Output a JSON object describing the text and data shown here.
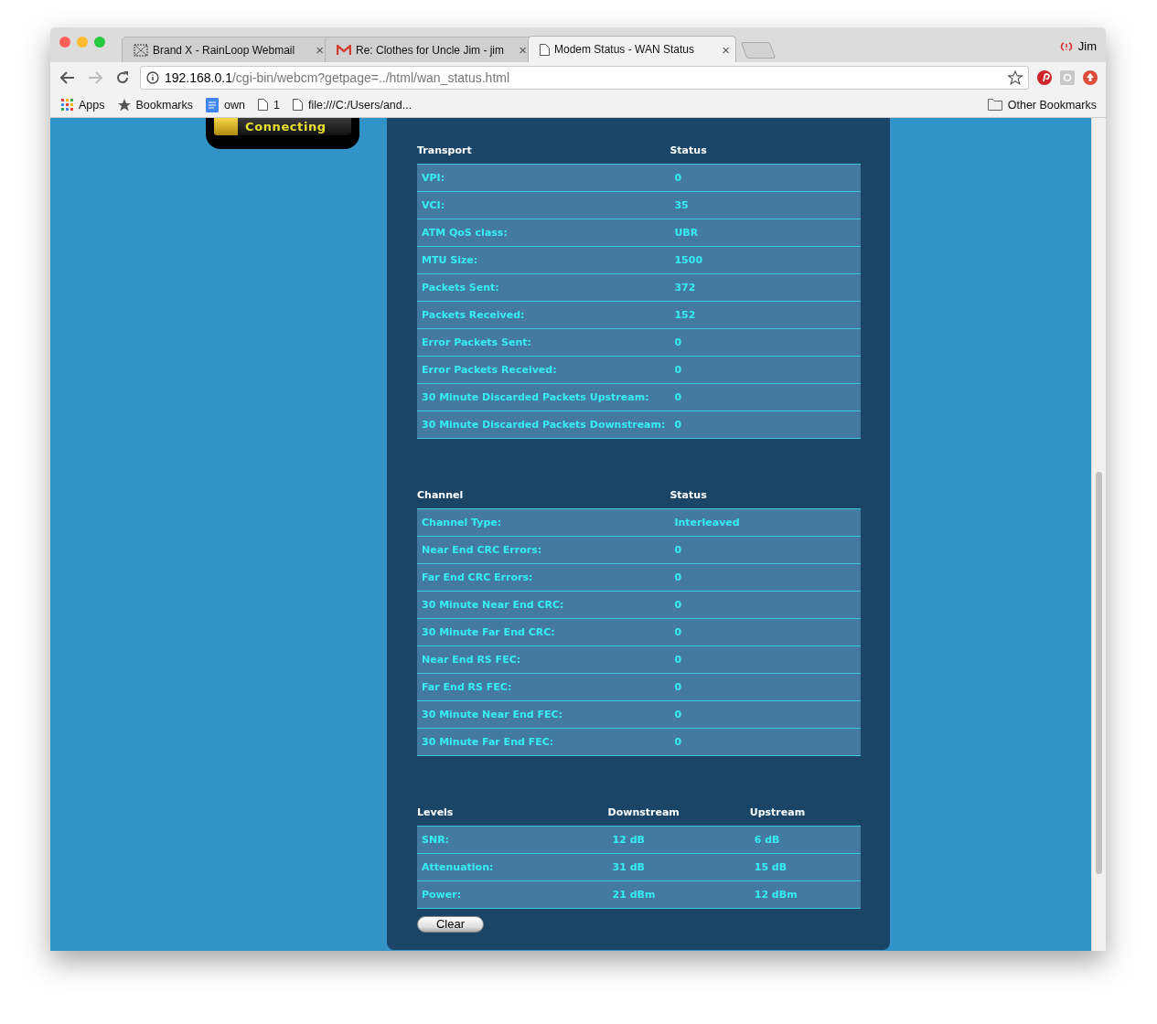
{
  "browser": {
    "tabs": [
      {
        "title": "Brand X - RainLoop Webmail",
        "close": "×",
        "selected": false
      },
      {
        "title": "Re: Clothes for Uncle Jim - jim",
        "close": "×",
        "selected": false
      },
      {
        "title": "Modem Status - WAN Status",
        "close": "×",
        "selected": true
      }
    ],
    "profile": "Jim",
    "address": {
      "host": "192.168.0.1",
      "path": "/cgi-bin/webcm?getpage=../html/wan_status.html"
    },
    "bookmarks": [
      "Apps",
      "Bookmarks",
      "own",
      "1",
      "file:///C:/Users/and..."
    ],
    "other_bookmarks": "Other Bookmarks"
  },
  "status_widget": {
    "label": "Connecting"
  },
  "tables": [
    {
      "columns": [
        "Transport",
        "Status"
      ],
      "rows": [
        [
          "VPI:",
          "0"
        ],
        [
          "VCI:",
          "35"
        ],
        [
          "ATM QoS class:",
          "UBR"
        ],
        [
          "MTU Size:",
          "1500"
        ],
        [
          "Packets Sent:",
          "372"
        ],
        [
          "Packets Received:",
          "152"
        ],
        [
          "Error Packets Sent:",
          "0"
        ],
        [
          "Error Packets Received:",
          "0"
        ],
        [
          "30 Minute Discarded Packets Upstream:",
          "0"
        ],
        [
          "30 Minute Discarded Packets Downstream:",
          "0"
        ]
      ]
    },
    {
      "columns": [
        "Channel",
        "Status"
      ],
      "rows": [
        [
          "Channel Type:",
          "Interleaved"
        ],
        [
          "Near End CRC Errors:",
          "0"
        ],
        [
          "Far End CRC Errors:",
          "0"
        ],
        [
          "30 Minute Near End CRC:",
          "0"
        ],
        [
          "30 Minute Far End CRC:",
          "0"
        ],
        [
          "Near End RS FEC:",
          "0"
        ],
        [
          "Far End RS FEC:",
          "0"
        ],
        [
          "30 Minute Near End FEC:",
          "0"
        ],
        [
          "30 Minute Far End FEC:",
          "0"
        ]
      ]
    },
    {
      "columns": [
        "Levels",
        "Downstream",
        "Upstream"
      ],
      "rows": [
        [
          "SNR:",
          "12 dB",
          "6 dB"
        ],
        [
          "Attenuation:",
          "31 dB",
          "15 dB"
        ],
        [
          "Power:",
          "21 dBm",
          "12 dBm"
        ]
      ]
    }
  ],
  "button": "Clear"
}
